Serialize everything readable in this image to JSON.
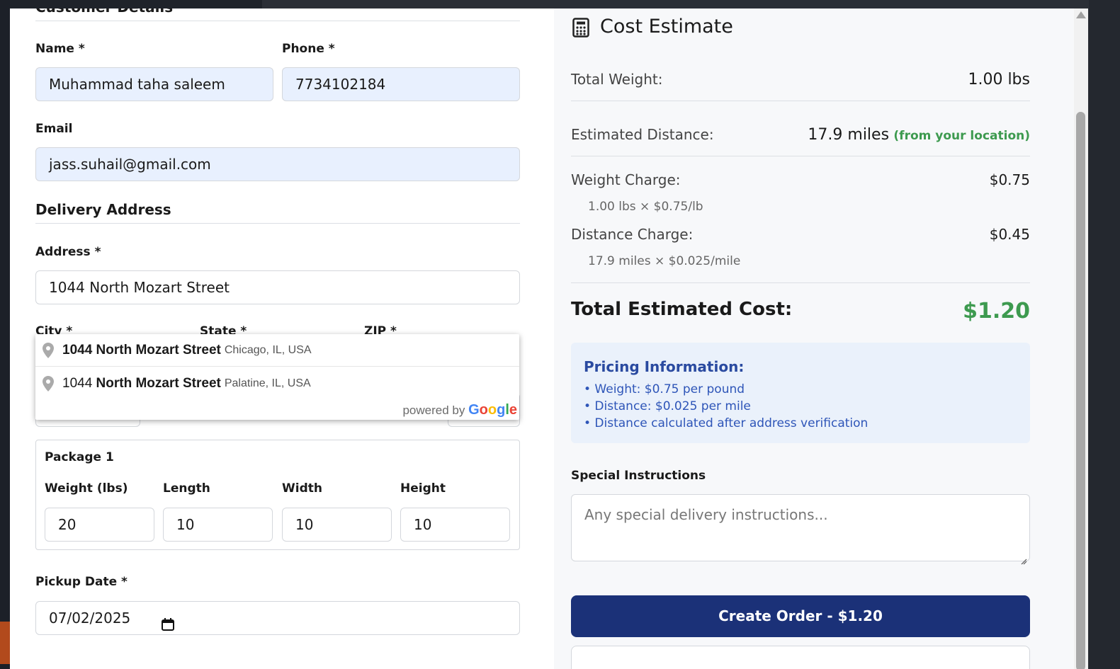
{
  "customer": {
    "section_title": "Customer Details",
    "name_label": "Name *",
    "name_value": "Muhammad taha saleem",
    "phone_label": "Phone *",
    "phone_value": "7734102184",
    "email_label": "Email",
    "email_value": "jass.suhail@gmail.com"
  },
  "delivery": {
    "section_title": "Delivery Address",
    "address_label": "Address *",
    "address_value": "1044 North Mozart Street",
    "city_label": "City *",
    "state_label": "State *",
    "zip_label": "ZIP *"
  },
  "autocomplete": {
    "items": [
      {
        "prefix": "",
        "bold": "1044 North Mozart Street",
        "secondary": "Chicago, IL, USA"
      },
      {
        "prefix": "1044 ",
        "bold": "North Mozart Street",
        "secondary": "Palatine, IL, USA"
      }
    ],
    "powered_by": "powered by",
    "google": {
      "g": "G",
      "o1": "o",
      "o2": "o",
      "g2": "g",
      "l": "l",
      "e": "e"
    }
  },
  "package": {
    "title": "Package 1",
    "weight_label": "Weight (lbs)",
    "length_label": "Length",
    "width_label": "Width",
    "height_label": "Height",
    "weight_value": "20",
    "length_value": "10",
    "width_value": "10",
    "height_value": "10"
  },
  "pickup": {
    "label": "Pickup Date *",
    "value": "07/02/2025"
  },
  "estimate": {
    "title": "Cost Estimate",
    "total_weight_label": "Total Weight:",
    "total_weight_value": "1.00 lbs",
    "distance_label": "Estimated Distance:",
    "distance_value": "17.9 miles",
    "distance_note": "(from your location)",
    "weight_charge_label": "Weight Charge:",
    "weight_charge_value": "$0.75",
    "weight_charge_detail": "1.00 lbs × $0.75/lb",
    "distance_charge_label": "Distance Charge:",
    "distance_charge_value": "$0.45",
    "distance_charge_detail": "17.9 miles × $0.025/mile",
    "total_label": "Total Estimated Cost:",
    "total_value": "$1.20"
  },
  "pricing_info": {
    "title": "Pricing Information:",
    "lines": [
      "• Weight: $0.75 per pound",
      "• Distance: $0.025 per mile",
      "• Distance calculated after address verification"
    ]
  },
  "instructions": {
    "label": "Special Instructions",
    "placeholder": "Any special delivery instructions..."
  },
  "actions": {
    "create_label": "Create Order - $1.20"
  },
  "colors": {
    "accent_green": "#3d9a4f",
    "primary_navy": "#1b3178",
    "autofill_blue": "#e8f0fe"
  }
}
